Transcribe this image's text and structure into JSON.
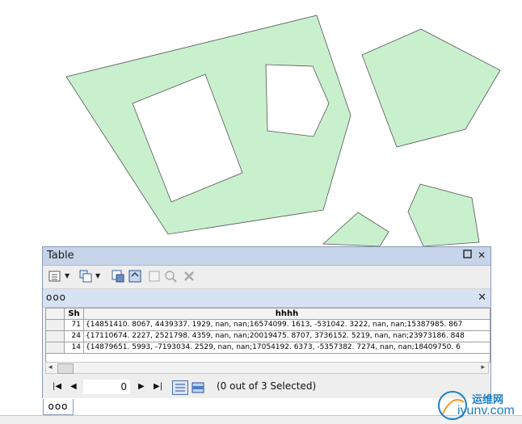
{
  "window": {
    "title": "Table"
  },
  "tab": {
    "name": "ooo"
  },
  "table": {
    "columns": [
      "",
      "Sh",
      "hhhh"
    ],
    "rows": [
      {
        "sh": "71",
        "hhhh": "{14851410. 8067, 4439337. 1929, nan, nan;16574099. 1613, -531042. 3222, nan, nan;15387985. 867"
      },
      {
        "sh": "24",
        "hhhh": "{17110674. 2227, 2521798. 4359, nan, nan;20019475. 8707, 3736152. 5219, nan, nan;23973186. 848"
      },
      {
        "sh": "14",
        "hhhh": "{14879651. 5993, -7193034. 2529, nan, nan;17054192. 6373, -5357382. 7274, nan, nan;18409750. 6"
      }
    ]
  },
  "navigation": {
    "record_value": "0",
    "status": "(0 out of 3 Selected)"
  },
  "bottom_tab": {
    "label": "ooo"
  },
  "watermark": {
    "cn": "运维网",
    "en": "iyunv.com"
  },
  "colors": {
    "polygon_fill": "#c9f0cd",
    "title_bar": "#c6d4ea",
    "tab_strip": "#d7e2f2"
  },
  "icons": [
    "table-options-icon",
    "related-tables-icon",
    "select-by-attributes-icon",
    "switch-selection-icon",
    "clear-selection-icon",
    "zoom-to-selected-icon",
    "delete-selected-icon",
    "first-record-icon",
    "previous-record-icon",
    "next-record-icon",
    "last-record-icon",
    "show-all-records-icon",
    "show-selected-records-icon",
    "window-restore-icon",
    "window-close-icon",
    "tab-close-icon"
  ]
}
